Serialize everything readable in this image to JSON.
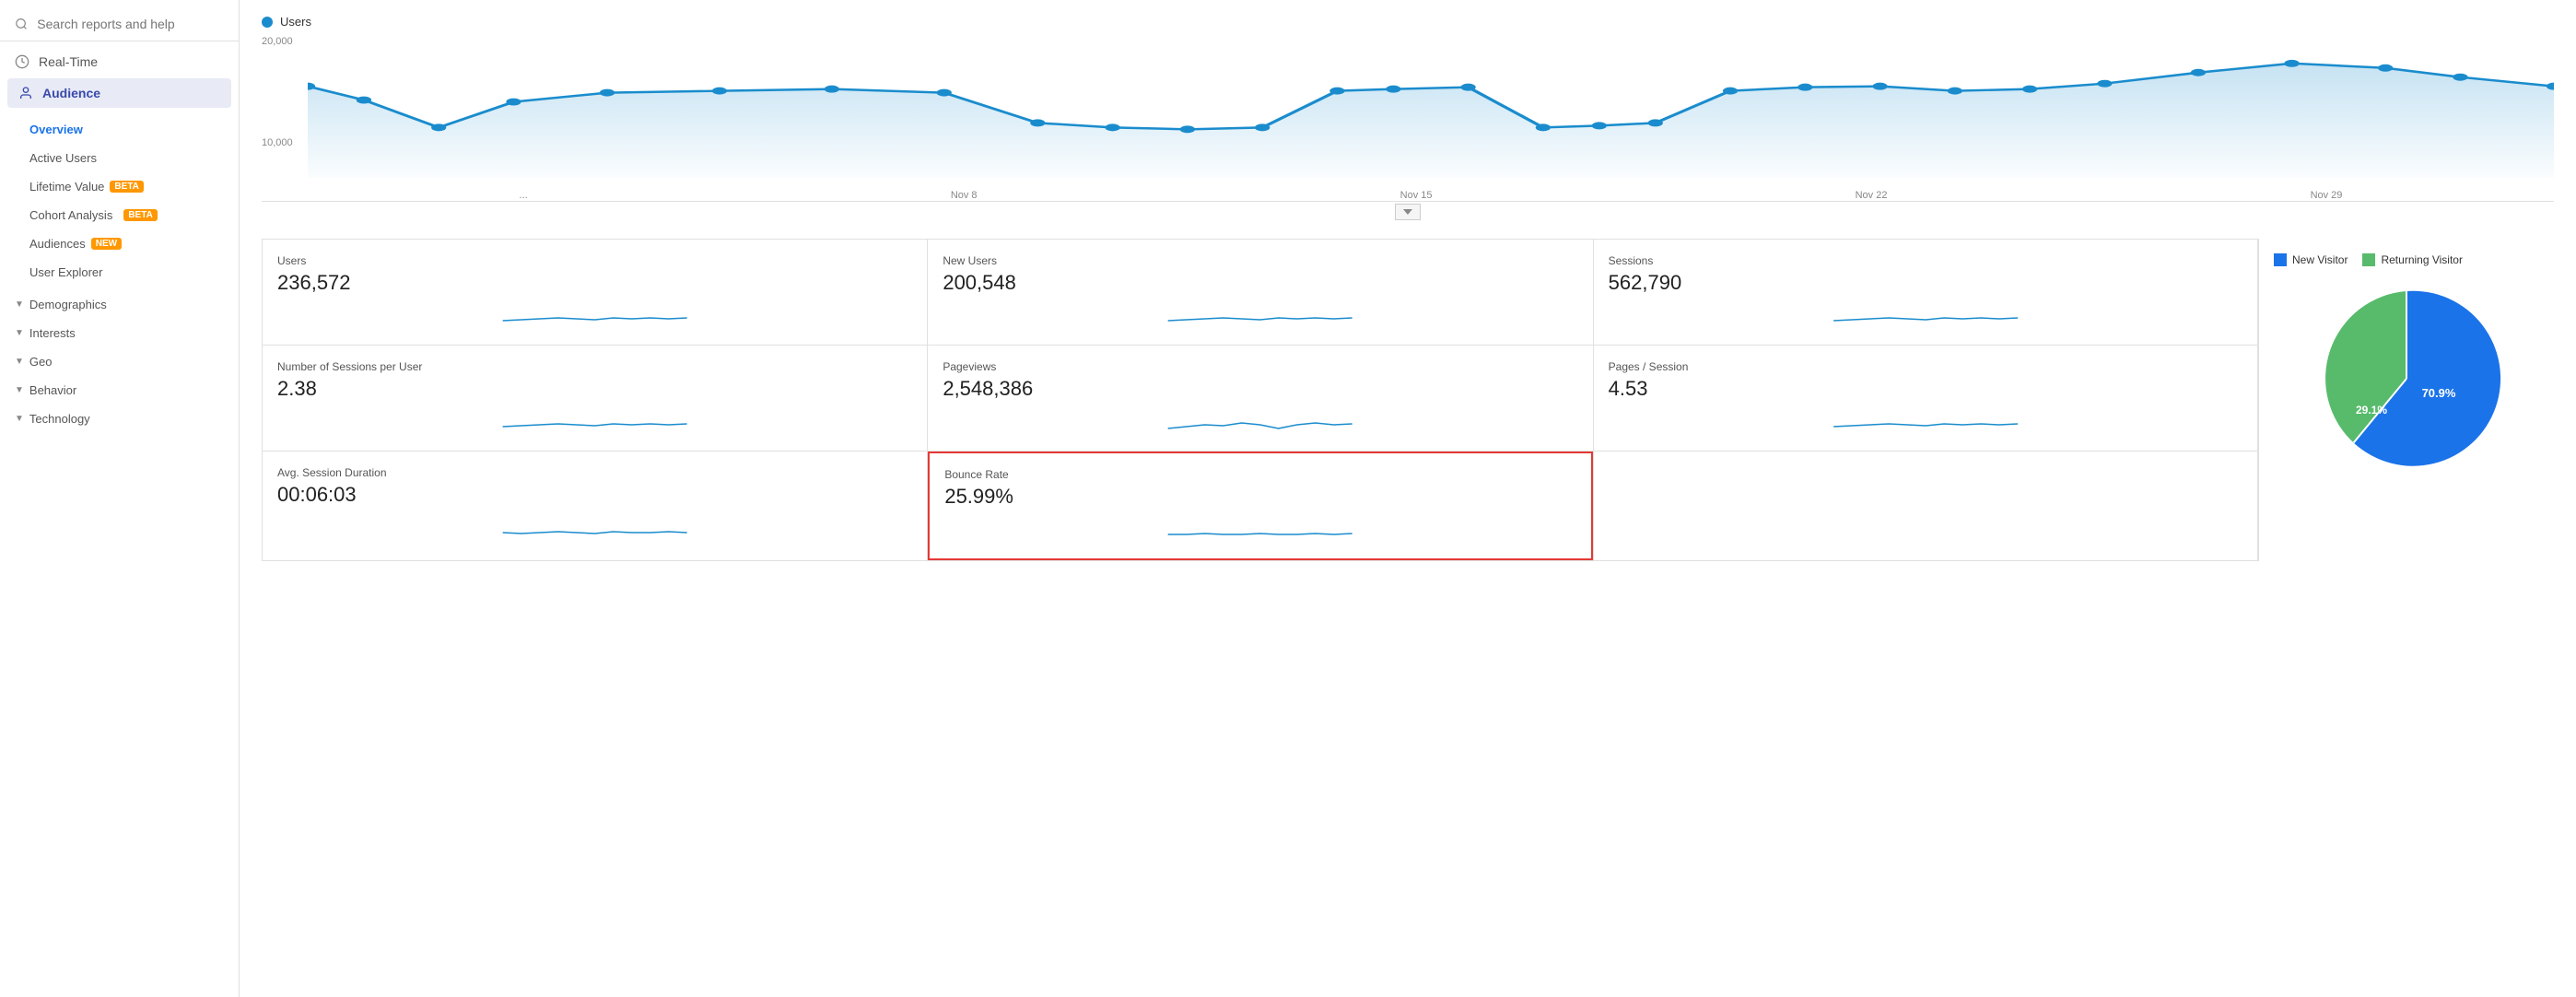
{
  "sidebar": {
    "search_placeholder": "Search reports and help",
    "nav_items": [
      {
        "id": "realtime",
        "label": "Real-Time",
        "icon": "clock"
      },
      {
        "id": "audience",
        "label": "Audience",
        "icon": "person",
        "active": true
      }
    ],
    "audience_sub": [
      {
        "id": "overview",
        "label": "Overview",
        "active": true
      },
      {
        "id": "active-users",
        "label": "Active Users",
        "badge": null
      },
      {
        "id": "lifetime-value",
        "label": "Lifetime Value",
        "badge": "BETA"
      },
      {
        "id": "cohort-analysis",
        "label": "Cohort Analysis",
        "badge": "BETA"
      },
      {
        "id": "audiences",
        "label": "Audiences",
        "badge": "NEW"
      },
      {
        "id": "user-explorer",
        "label": "User Explorer",
        "badge": null
      }
    ],
    "nav_groups": [
      {
        "id": "demographics",
        "label": "Demographics"
      },
      {
        "id": "interests",
        "label": "Interests"
      },
      {
        "id": "geo",
        "label": "Geo"
      },
      {
        "id": "behavior",
        "label": "Behavior"
      },
      {
        "id": "technology",
        "label": "Technology"
      }
    ]
  },
  "chart": {
    "legend_label": "Users",
    "legend_color": "#1a8ccd",
    "y_labels": [
      "20,000",
      "",
      "10,000",
      ""
    ],
    "x_labels": [
      "...",
      "Nov 8",
      "Nov 15",
      "Nov 22",
      "Nov 29"
    ]
  },
  "metrics": [
    {
      "id": "users",
      "label": "Users",
      "value": "236,572",
      "highlighted": false
    },
    {
      "id": "new-users",
      "label": "New Users",
      "value": "200,548",
      "highlighted": false
    },
    {
      "id": "sessions",
      "label": "Sessions",
      "value": "562,790",
      "highlighted": false
    },
    {
      "id": "sessions-per-user",
      "label": "Number of Sessions per User",
      "value": "2.38",
      "highlighted": false
    },
    {
      "id": "pageviews",
      "label": "Pageviews",
      "value": "2,548,386",
      "highlighted": false
    },
    {
      "id": "pages-per-session",
      "label": "Pages / Session",
      "value": "4.53",
      "highlighted": false
    },
    {
      "id": "avg-session-duration",
      "label": "Avg. Session Duration",
      "value": "00:06:03",
      "highlighted": false
    },
    {
      "id": "bounce-rate",
      "label": "Bounce Rate",
      "value": "25.99%",
      "highlighted": true
    }
  ],
  "pie": {
    "new_visitor_label": "New Visitor",
    "returning_visitor_label": "Returning Visitor",
    "new_visitor_color": "#1a73e8",
    "returning_visitor_color": "#57bb6b",
    "new_visitor_pct": 70.9,
    "returning_visitor_pct": 29.1,
    "new_visitor_pct_label": "70.9%",
    "returning_visitor_pct_label": "29.1%"
  }
}
